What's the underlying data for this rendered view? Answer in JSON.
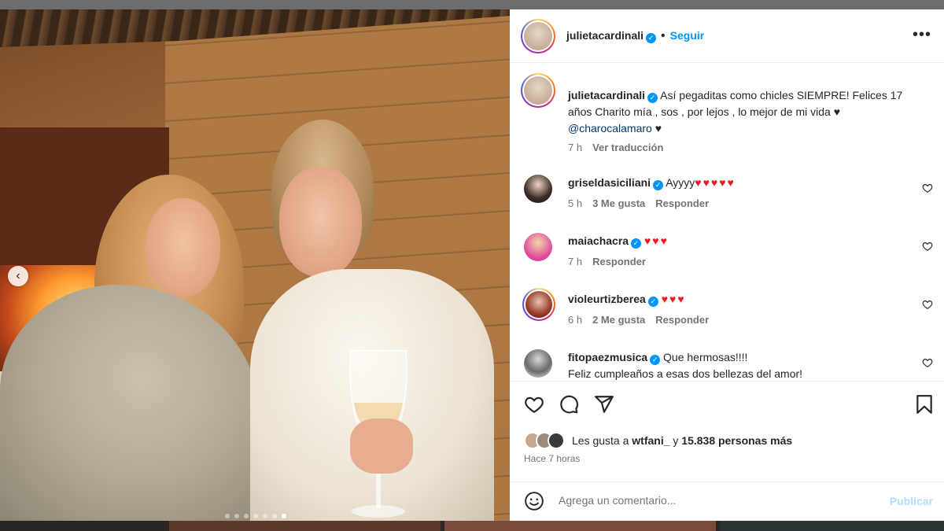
{
  "post": {
    "author": "julietacardinali",
    "follow_label": "Seguir",
    "dot": "•",
    "more_icon": "more-options-icon",
    "caption": "Así pegaditas como chicles SIEMPRE! Felices 17 años Charito mía , sos , por lejos , lo mejor de mi vida ♥",
    "caption_mention": "@charocalamaro",
    "caption_end": "♥",
    "caption_time": "7 h",
    "translate_label": "Ver traducción",
    "carousel": {
      "total": 7,
      "active_index": 6,
      "prev_icon": "chevron-left-icon",
      "prev_glyph": "‹"
    }
  },
  "comments": [
    {
      "user": "griseldasiciliani",
      "verified": true,
      "text": "Ayyyy",
      "hearts": "♥♥♥♥♥",
      "time": "5 h",
      "likes": "3 Me gusta",
      "reply": "Responder"
    },
    {
      "user": "maiachacra",
      "verified": true,
      "text": "",
      "hearts": "♥♥♥",
      "time": "7 h",
      "likes": "",
      "reply": "Responder"
    },
    {
      "user": "violeurtizberea",
      "verified": true,
      "text": "",
      "hearts": "♥♥♥",
      "time": "6 h",
      "likes": "2 Me gusta",
      "reply": "Responder"
    },
    {
      "user": "fitopaezmusica",
      "verified": true,
      "text": "Que hermosas!!!!",
      "text2": "Feliz cumpleaños a esas dos bellezas del amor!",
      "hearts": ""
    }
  ],
  "actions": {
    "like_icon": "heart-icon",
    "comment_icon": "comment-icon",
    "share_icon": "send-icon",
    "save_icon": "bookmark-icon",
    "likes_prefix": "Les gusta a",
    "likes_user": "wtfani_",
    "likes_connector": "y",
    "likes_count": "15.838 personas más",
    "posted_ago": "Hace 7 horas"
  },
  "add_comment": {
    "emoji_icon": "emoji-icon",
    "placeholder": "Agrega un comentario...",
    "publish_label": "Publicar"
  },
  "colors": {
    "accent": "#0095f6",
    "heart_red": "#ed1c24",
    "publish_disabled": "#b3dbff",
    "muted": "#737373"
  }
}
